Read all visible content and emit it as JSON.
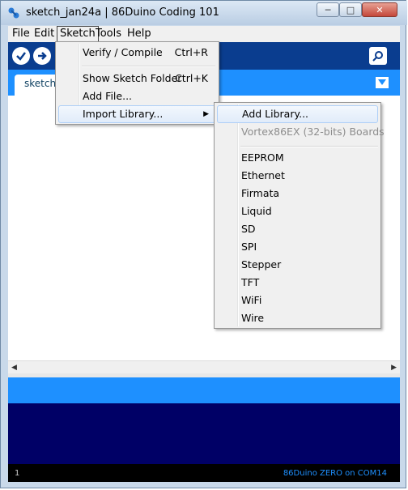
{
  "window": {
    "title": "sketch_jan24a | 86Duino Coding 101"
  },
  "menubar": {
    "items": [
      "File",
      "Edit",
      "Sketch",
      "Tools",
      "Help"
    ]
  },
  "tabs": {
    "active_label": "sketch_"
  },
  "sketch_menu": {
    "verify": {
      "label": "Verify / Compile",
      "shortcut": "Ctrl+R"
    },
    "show_folder": {
      "label": "Show Sketch Folder",
      "shortcut": "Ctrl+K"
    },
    "add_file": {
      "label": "Add File..."
    },
    "import_library": {
      "label": "Import Library..."
    }
  },
  "library_menu": {
    "add_library": "Add Library...",
    "board_header": "Vortex86EX (32-bits) Boards",
    "libraries": [
      "EEPROM",
      "Ethernet",
      "Firmata",
      "Liquid",
      "SD",
      "SPI",
      "Stepper",
      "TFT",
      "WiFi",
      "Wire"
    ]
  },
  "status": {
    "line": "1",
    "board": "86Duino ZERO on COM14"
  },
  "colors": {
    "toolbar": "#0a3d8f",
    "tabbar": "#1e90ff",
    "console": "#000066",
    "status_text": "#1e90ff"
  }
}
